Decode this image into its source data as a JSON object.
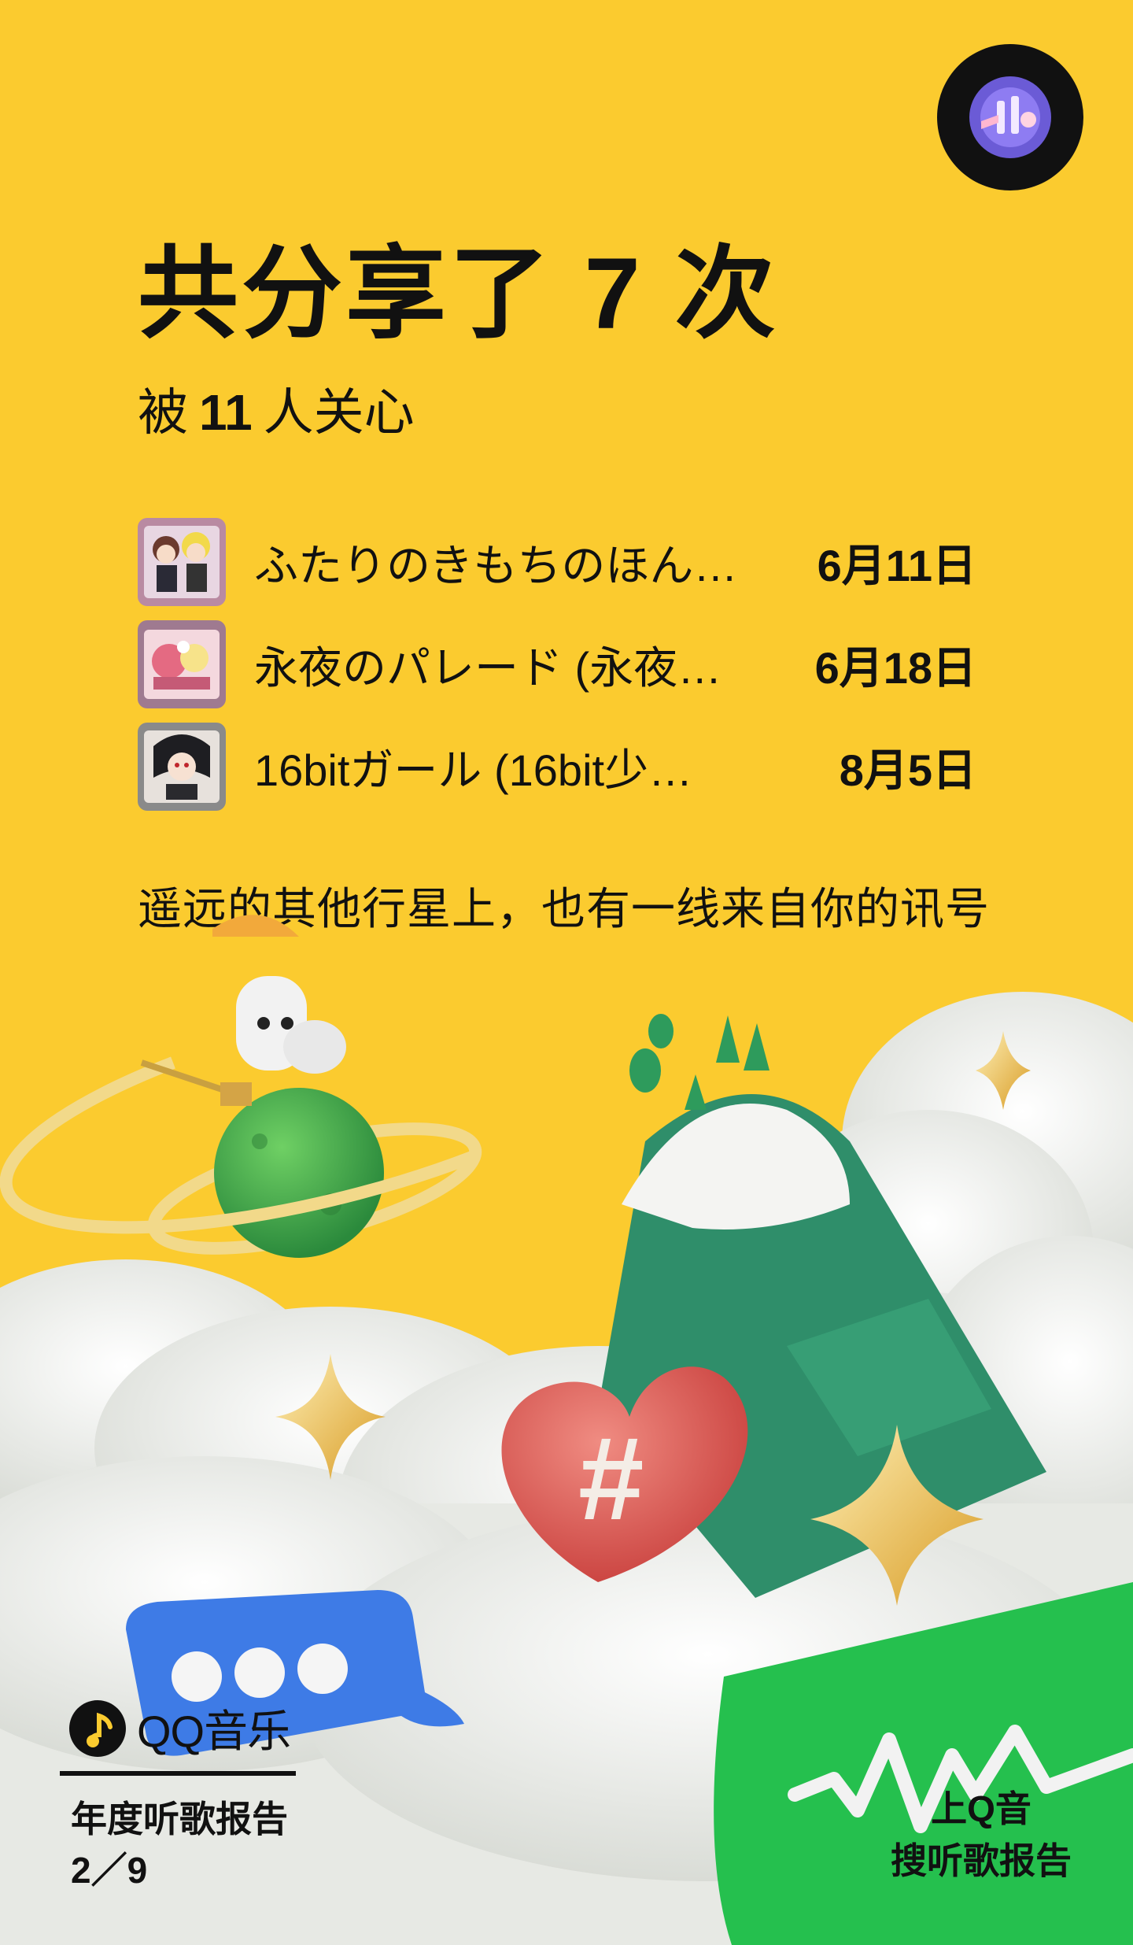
{
  "header": {
    "headline": "共分享了 7 次",
    "subline_prefix": "被",
    "subline_count": "11",
    "subline_suffix": "人关心"
  },
  "shared_songs": [
    {
      "title": "ふたりのきもちのほん…",
      "date": "6月11日",
      "cover_icon": "album-cover-anime-duo"
    },
    {
      "title": "永夜のパレード (永夜…",
      "date": "6月18日",
      "cover_icon": "album-cover-parade"
    },
    {
      "title": "16bitガール (16bit少…",
      "date": "8月5日",
      "cover_icon": "album-cover-16bit-girl"
    }
  ],
  "tagline": "遥远的其他行星上，也有一线来自你的讯号",
  "footer": {
    "brand": "QQ音乐",
    "report_label": "年度听歌报告",
    "page_indicator": "2／9",
    "cta_line1": "上Q音",
    "cta_line2": "搜听歌报告"
  },
  "colors": {
    "background": "#FBCB2F",
    "text": "#111111",
    "cloud": "#ECEEEA",
    "planet": "#3FA84A",
    "heart": "#E0605A",
    "mountain": "#2F8E6A",
    "star": "#E9B93A",
    "bubble_blue": "#3E7BE6",
    "bubble_green": "#25C04E"
  },
  "icons": [
    "avatar-icon",
    "qq-music-logo-icon",
    "planet-icon",
    "heart-hashtag-icon",
    "chat-bubble-icon",
    "waveform-bubble-icon",
    "sparkle-icon"
  ]
}
